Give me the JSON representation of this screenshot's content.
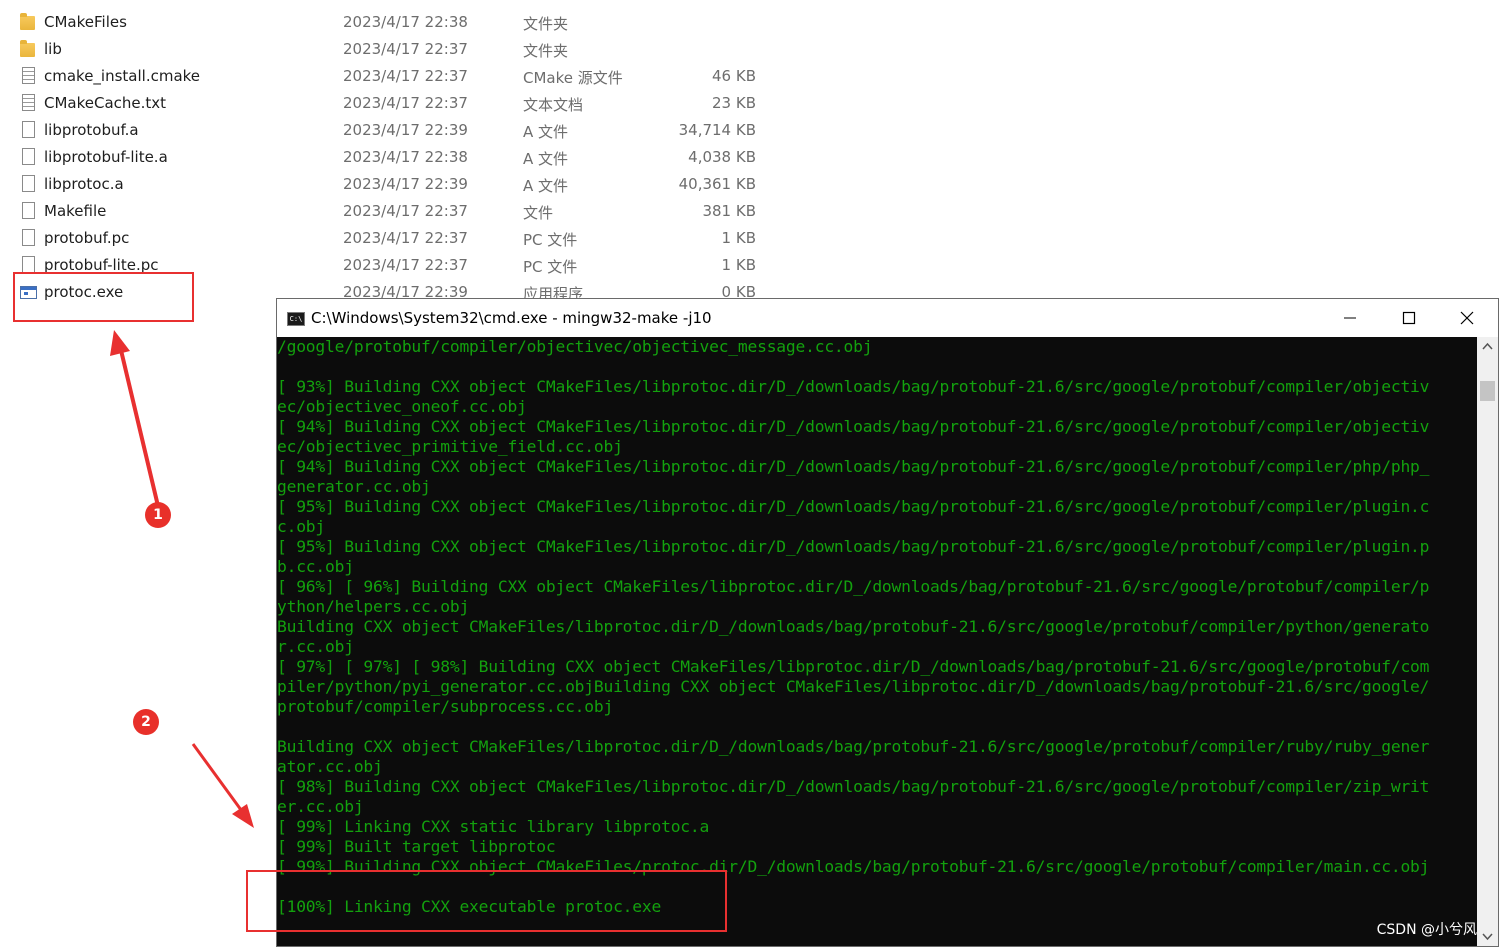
{
  "explorer": {
    "files": [
      {
        "name": "CMakeFiles",
        "date": "2023/4/17 22:38",
        "type": "文件夹",
        "size": "",
        "icon": "folder-icon"
      },
      {
        "name": "lib",
        "date": "2023/4/17 22:37",
        "type": "文件夹",
        "size": "",
        "icon": "folder-icon"
      },
      {
        "name": "cmake_install.cmake",
        "date": "2023/4/17 22:37",
        "type": "CMake 源文件",
        "size": "46 KB",
        "icon": "text-file-icon"
      },
      {
        "name": "CMakeCache.txt",
        "date": "2023/4/17 22:37",
        "type": "文本文档",
        "size": "23 KB",
        "icon": "text-file-icon"
      },
      {
        "name": "libprotobuf.a",
        "date": "2023/4/17 22:39",
        "type": "A 文件",
        "size": "34,714 KB",
        "icon": "file-icon"
      },
      {
        "name": "libprotobuf-lite.a",
        "date": "2023/4/17 22:38",
        "type": "A 文件",
        "size": "4,038 KB",
        "icon": "file-icon"
      },
      {
        "name": "libprotoc.a",
        "date": "2023/4/17 22:39",
        "type": "A 文件",
        "size": "40,361 KB",
        "icon": "file-icon"
      },
      {
        "name": "Makefile",
        "date": "2023/4/17 22:37",
        "type": "文件",
        "size": "381 KB",
        "icon": "file-icon"
      },
      {
        "name": "protobuf.pc",
        "date": "2023/4/17 22:37",
        "type": "PC 文件",
        "size": "1 KB",
        "icon": "file-icon"
      },
      {
        "name": "protobuf-lite.pc",
        "date": "2023/4/17 22:37",
        "type": "PC 文件",
        "size": "1 KB",
        "icon": "file-icon"
      },
      {
        "name": "protoc.exe",
        "date": "2023/4/17 22:39",
        "type": "应用程序",
        "size": "0 KB",
        "icon": "exe-icon"
      }
    ]
  },
  "annotations": {
    "badge1": "1",
    "badge2": "2",
    "color": "#e83030"
  },
  "cmd": {
    "icon_text": "C:\\",
    "title": "C:\\Windows\\System32\\cmd.exe - mingw32-make  -j10",
    "text_color": "#13a10e",
    "background": "#0c0c0c",
    "lines": [
      "/google/protobuf/compiler/objectivec/objectivec_message.cc.obj",
      "",
      "[ 93%] Building CXX object CMakeFiles/libprotoc.dir/D_/downloads/bag/protobuf-21.6/src/google/protobuf/compiler/objectiv",
      "ec/objectivec_oneof.cc.obj",
      "[ 94%] Building CXX object CMakeFiles/libprotoc.dir/D_/downloads/bag/protobuf-21.6/src/google/protobuf/compiler/objectiv",
      "ec/objectivec_primitive_field.cc.obj",
      "[ 94%] Building CXX object CMakeFiles/libprotoc.dir/D_/downloads/bag/protobuf-21.6/src/google/protobuf/compiler/php/php_",
      "generator.cc.obj",
      "[ 95%] Building CXX object CMakeFiles/libprotoc.dir/D_/downloads/bag/protobuf-21.6/src/google/protobuf/compiler/plugin.c",
      "c.obj",
      "[ 95%] Building CXX object CMakeFiles/libprotoc.dir/D_/downloads/bag/protobuf-21.6/src/google/protobuf/compiler/plugin.p",
      "b.cc.obj",
      "[ 96%] [ 96%] Building CXX object CMakeFiles/libprotoc.dir/D_/downloads/bag/protobuf-21.6/src/google/protobuf/compiler/p",
      "ython/helpers.cc.obj",
      "Building CXX object CMakeFiles/libprotoc.dir/D_/downloads/bag/protobuf-21.6/src/google/protobuf/compiler/python/generato",
      "r.cc.obj",
      "[ 97%] [ 97%] [ 98%] Building CXX object CMakeFiles/libprotoc.dir/D_/downloads/bag/protobuf-21.6/src/google/protobuf/com",
      "piler/python/pyi_generator.cc.objBuilding CXX object CMakeFiles/libprotoc.dir/D_/downloads/bag/protobuf-21.6/src/google/",
      "protobuf/compiler/subprocess.cc.obj",
      "",
      "Building CXX object CMakeFiles/libprotoc.dir/D_/downloads/bag/protobuf-21.6/src/google/protobuf/compiler/ruby/ruby_gener",
      "ator.cc.obj",
      "[ 98%] Building CXX object CMakeFiles/libprotoc.dir/D_/downloads/bag/protobuf-21.6/src/google/protobuf/compiler/zip_writ",
      "er.cc.obj",
      "[ 99%] Linking CXX static library libprotoc.a",
      "[ 99%] Built target libprotoc",
      "[ 99%] Building CXX object CMakeFiles/protoc.dir/D_/downloads/bag/protobuf-21.6/src/google/protobuf/compiler/main.cc.obj",
      "",
      "[100%] Linking CXX executable protoc.exe"
    ]
  },
  "watermark": "CSDN @小兮风"
}
